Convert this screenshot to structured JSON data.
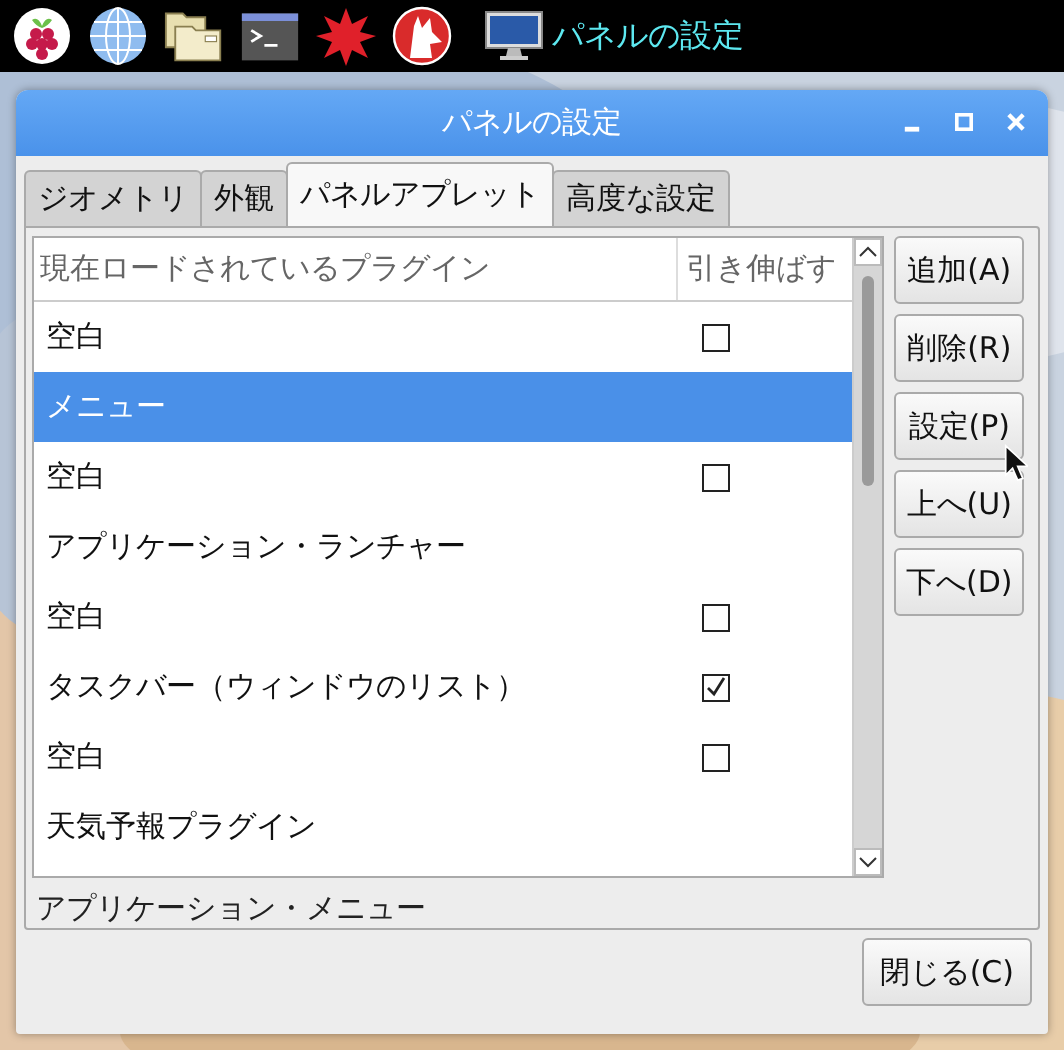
{
  "taskbar": {
    "window_button": "パネルの設定"
  },
  "window": {
    "title": "パネルの設定"
  },
  "tabs": [
    {
      "label": "ジオメトリ",
      "selected": false
    },
    {
      "label": "外観",
      "selected": false
    },
    {
      "label": "パネルアプレット",
      "selected": true
    },
    {
      "label": "高度な設定",
      "selected": false
    }
  ],
  "table": {
    "columns": [
      "現在ロードされているプラグイン",
      "引き伸ばす"
    ],
    "rows": [
      {
        "name": "空白",
        "selected": false,
        "checked": false
      },
      {
        "name": "メニュー",
        "selected": true
      },
      {
        "name": "空白",
        "selected": false,
        "checked": false
      },
      {
        "name": "アプリケーション・ランチャー",
        "selected": false
      },
      {
        "name": "空白",
        "selected": false,
        "checked": false
      },
      {
        "name": "タスクバー（ウィンドウのリスト）",
        "selected": false,
        "checked": true
      },
      {
        "name": "空白",
        "selected": false,
        "checked": false
      },
      {
        "name": "天気予報プラグイン",
        "selected": false
      }
    ]
  },
  "side_buttons": [
    "追加(A)",
    "削除(R)",
    "設定(P)",
    "上へ(U)",
    "下へ(D)"
  ],
  "description": "アプリケーション・メニュー",
  "buttons": [
    "閉じる(C)"
  ]
}
